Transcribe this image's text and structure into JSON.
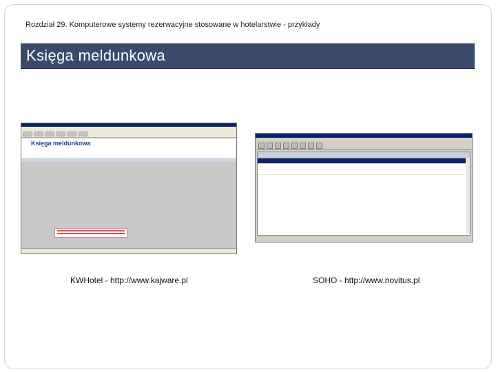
{
  "header": {
    "chapter": "Rozdział 29. Komputerowe systemy rezerwacyjne stosowane w hotelarstwie - przykłady",
    "title": "Księga meldunkowa"
  },
  "left_screenshot": {
    "app_title": "Księga meldunkowa",
    "caption": "KWHotel - http://www.kajware.pl"
  },
  "right_screenshot": {
    "caption": "SOHO - http://www.novitus.pl"
  },
  "colors": {
    "title_bar": "#3b4a6b",
    "title_text": "#ffffff",
    "window_title": "#0a246a"
  }
}
